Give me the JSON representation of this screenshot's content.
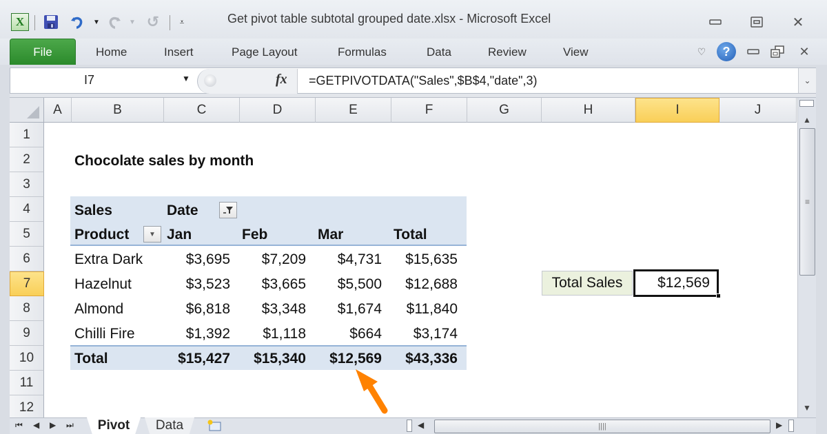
{
  "window": {
    "title": "Get pivot table subtotal grouped date.xlsx  -  Microsoft Excel",
    "controls": [
      "minimize-icon",
      "restore-icon",
      "close-icon"
    ]
  },
  "quick_access": {
    "icons": [
      "excel-logo-icon",
      "save-icon",
      "undo-icon",
      "undo-dropdown-icon",
      "redo-icon",
      "redo-dropdown-icon",
      "repeat-icon",
      "customize-qat-icon"
    ]
  },
  "ribbon": {
    "file_label": "File",
    "tabs": [
      "Home",
      "Insert",
      "Page Layout",
      "Formulas",
      "Data",
      "Review",
      "View"
    ],
    "right_icons": [
      "minimize-ribbon-icon",
      "help-icon",
      "window-minimize-icon",
      "window-restore-icon",
      "window-close-icon"
    ],
    "help_glyph": "?"
  },
  "formula_bar": {
    "name_box": "I7",
    "fx_label": "fx",
    "formula": "=GETPIVOTDATA(\"Sales\",$B$4,\"date\",3)"
  },
  "sheet": {
    "columns": [
      "A",
      "B",
      "C",
      "D",
      "E",
      "F",
      "G",
      "H",
      "I",
      "J"
    ],
    "selected_column": "I",
    "rows": [
      "1",
      "2",
      "3",
      "4",
      "5",
      "6",
      "7",
      "8",
      "9",
      "10",
      "11",
      "12"
    ],
    "selected_row": "7",
    "title": "Chocolate sales by month",
    "pivot": {
      "values_label": "Sales",
      "column_field": "Date",
      "row_field": "Product",
      "headers": [
        "Jan",
        "Feb",
        "Mar",
        "Total"
      ],
      "rows": [
        {
          "product": "Extra Dark",
          "values": [
            "$3,695",
            "$7,209",
            "$4,731",
            "$15,635"
          ]
        },
        {
          "product": "Hazelnut",
          "values": [
            "$3,523",
            "$3,665",
            "$5,500",
            "$12,688"
          ]
        },
        {
          "product": "Almond",
          "values": [
            "$6,818",
            "$3,348",
            "$1,674",
            "$11,840"
          ]
        },
        {
          "product": "Chilli Fire",
          "values": [
            "$1,392",
            "$1,118",
            "$664",
            "$3,174"
          ]
        }
      ],
      "total_label": "Total",
      "totals": [
        "$15,427",
        "$15,340",
        "$12,569",
        "$43,336"
      ],
      "accent_color": "#dbe5f1"
    },
    "result": {
      "label": "Total Sales",
      "value": "$12,569"
    },
    "annotation_color": "#ff8200"
  },
  "sheet_tabs": {
    "tabs": [
      "Pivot",
      "Data"
    ],
    "active": "Pivot"
  }
}
